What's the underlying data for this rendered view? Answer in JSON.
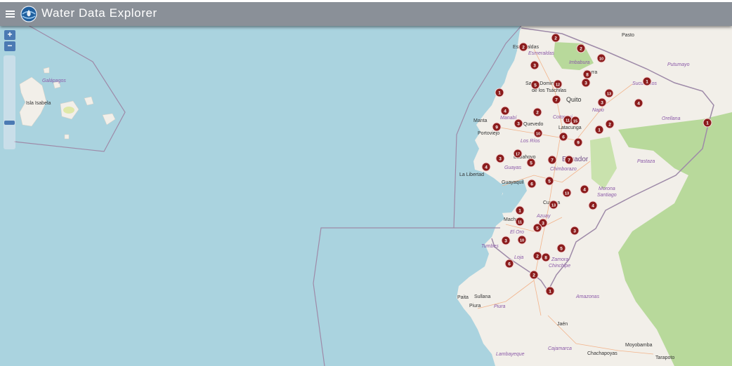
{
  "header": {
    "title": "Water Data Explorer",
    "menu_icon": "hamburger-icon",
    "logo_icon": "globe-water-logo-icon"
  },
  "zoom": {
    "in_label": "+",
    "out_label": "−",
    "level_fraction": 0.73
  },
  "colors": {
    "water": "#aad3df",
    "land": "#f2efe9",
    "forest": "#b8d99b",
    "marker": "#8b1c1c",
    "border": "#9e8aa8",
    "header": "#8a9098"
  },
  "map": {
    "place_labels": [
      {
        "text": "Galápagos",
        "kind": "region"
      },
      {
        "text": "Isla Isabela",
        "kind": "place"
      },
      {
        "text": "Pasto",
        "kind": "place"
      },
      {
        "text": "Esmeraldas",
        "kind": "place"
      },
      {
        "text": "Esmeraldas",
        "kind": "region"
      },
      {
        "text": "Imbabura",
        "kind": "region"
      },
      {
        "text": "Ibarra",
        "kind": "place"
      },
      {
        "text": "Putumayo",
        "kind": "region"
      },
      {
        "text": "Sucumbíos",
        "kind": "region"
      },
      {
        "text": "Santo Domingo",
        "kind": "place"
      },
      {
        "text": "de los Tsáchilas",
        "kind": "place"
      },
      {
        "text": "Quito",
        "kind": "capital"
      },
      {
        "text": "Napo",
        "kind": "region"
      },
      {
        "text": "Orellana",
        "kind": "region"
      },
      {
        "text": "Manta",
        "kind": "place"
      },
      {
        "text": "Manabí",
        "kind": "region"
      },
      {
        "text": "Quevedo",
        "kind": "place"
      },
      {
        "text": "Cotopaxi",
        "kind": "region"
      },
      {
        "text": "Latacunga",
        "kind": "place"
      },
      {
        "text": "Portoviejo",
        "kind": "place"
      },
      {
        "text": "Los Ríos",
        "kind": "region"
      },
      {
        "text": "Babahoyo",
        "kind": "place"
      },
      {
        "text": "Ecuador",
        "kind": "country"
      },
      {
        "text": "Pastaza",
        "kind": "region"
      },
      {
        "text": "La Libertad",
        "kind": "place"
      },
      {
        "text": "Guayas",
        "kind": "region"
      },
      {
        "text": "Chimborazo",
        "kind": "region"
      },
      {
        "text": "Guayaquil",
        "kind": "place"
      },
      {
        "text": "Morona",
        "kind": "region"
      },
      {
        "text": "Santiago",
        "kind": "region"
      },
      {
        "text": "Cuenca",
        "kind": "place"
      },
      {
        "text": "Azuay",
        "kind": "region"
      },
      {
        "text": "Machala",
        "kind": "place"
      },
      {
        "text": "El Oro",
        "kind": "region"
      },
      {
        "text": "Tumbes",
        "kind": "region"
      },
      {
        "text": "Loja",
        "kind": "region"
      },
      {
        "text": "Zamora",
        "kind": "region"
      },
      {
        "text": "Chinchipe",
        "kind": "region"
      },
      {
        "text": "Paita",
        "kind": "place"
      },
      {
        "text": "Sullana",
        "kind": "place"
      },
      {
        "text": "Piura",
        "kind": "place"
      },
      {
        "text": "Piura",
        "kind": "region"
      },
      {
        "text": "Amazonas",
        "kind": "region"
      },
      {
        "text": "Jaén",
        "kind": "place"
      },
      {
        "text": "Cajamarca",
        "kind": "region"
      },
      {
        "text": "Lambayeque",
        "kind": "region"
      },
      {
        "text": "Chachapoyas",
        "kind": "place"
      },
      {
        "text": "Moyobamba",
        "kind": "place"
      },
      {
        "text": "Tarapoto",
        "kind": "place"
      }
    ],
    "markers": [
      {
        "count": "2"
      },
      {
        "count": "2"
      },
      {
        "count": "2"
      },
      {
        "count": "10"
      },
      {
        "count": "3"
      },
      {
        "count": "8"
      },
      {
        "count": "5"
      },
      {
        "count": "12"
      },
      {
        "count": "3"
      },
      {
        "count": "1"
      },
      {
        "count": "13"
      },
      {
        "count": "1"
      },
      {
        "count": "7"
      },
      {
        "count": "3"
      },
      {
        "count": "4"
      },
      {
        "count": "4"
      },
      {
        "count": "2"
      },
      {
        "count": "11"
      },
      {
        "count": "15"
      },
      {
        "count": "2"
      },
      {
        "count": "9"
      },
      {
        "count": "3"
      },
      {
        "count": "10"
      },
      {
        "count": "1"
      },
      {
        "count": "1"
      },
      {
        "count": "6"
      },
      {
        "count": "9"
      },
      {
        "count": "17"
      },
      {
        "count": "3"
      },
      {
        "count": "5"
      },
      {
        "count": "7"
      },
      {
        "count": "7"
      },
      {
        "count": "4"
      },
      {
        "count": "5"
      },
      {
        "count": "6"
      },
      {
        "count": "4"
      },
      {
        "count": "13"
      },
      {
        "count": "13"
      },
      {
        "count": "4"
      },
      {
        "count": "1"
      },
      {
        "count": "11"
      },
      {
        "count": "3"
      },
      {
        "count": "5"
      },
      {
        "count": "3"
      },
      {
        "count": "3"
      },
      {
        "count": "10"
      },
      {
        "count": "5"
      },
      {
        "count": "2"
      },
      {
        "count": "8"
      },
      {
        "count": "6"
      },
      {
        "count": "2"
      },
      {
        "count": "1"
      }
    ]
  }
}
